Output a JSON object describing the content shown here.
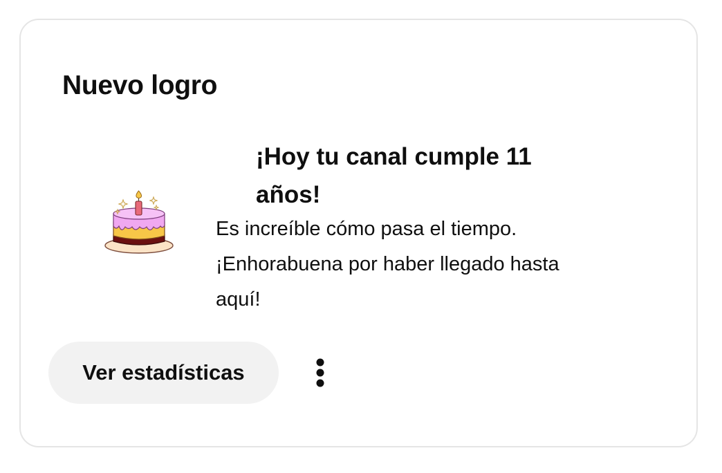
{
  "card": {
    "title": "Nuevo logro",
    "headline": "¡Hoy tu canal cumple 11 años!",
    "message": "Es increíble cómo pasa el tiempo. ¡Enhorabuena por haber llegado hasta aquí!",
    "illustration_icon": "birthday-cake-icon",
    "primary_button_label": "Ver estadísticas",
    "more_icon": "more-vert-icon"
  },
  "colors": {
    "border": "#e5e5e5",
    "button_background": "#f2f2f2",
    "text": "#0f0f0f",
    "cake_frosting": "#f0a8f0",
    "cake_layer": "#f7c748",
    "cake_base": "#6b1010",
    "plate": "#fbe3c6"
  }
}
